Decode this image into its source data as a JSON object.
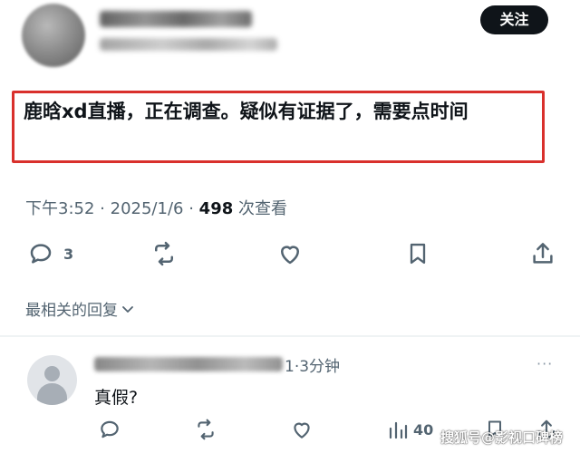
{
  "header": {
    "follow_label": "关注"
  },
  "post": {
    "text": "鹿晗xd直播，正在调查。疑似有证据了，需要点时间",
    "time": "下午3:52",
    "date": "2025/1/6",
    "views_count": "498",
    "views_suffix": "次查看",
    "sep": "·",
    "reply_count": "3"
  },
  "sort": {
    "label": "最相关的回复"
  },
  "reply": {
    "suffix": "1·3分钟",
    "text": "真假?",
    "more": "···",
    "views_count": "40"
  },
  "watermark": {
    "text": "搜狐号@影视口碑榜"
  },
  "colors": {
    "accent_border": "#d9302c",
    "muted_text": "#536471",
    "primary_text": "#0f1419",
    "follow_bg": "#0f1419"
  },
  "icons": [
    "reply-icon",
    "retweet-icon",
    "like-icon",
    "bookmark-icon",
    "share-icon",
    "chevron-down-icon",
    "views-icon",
    "more-icon"
  ]
}
